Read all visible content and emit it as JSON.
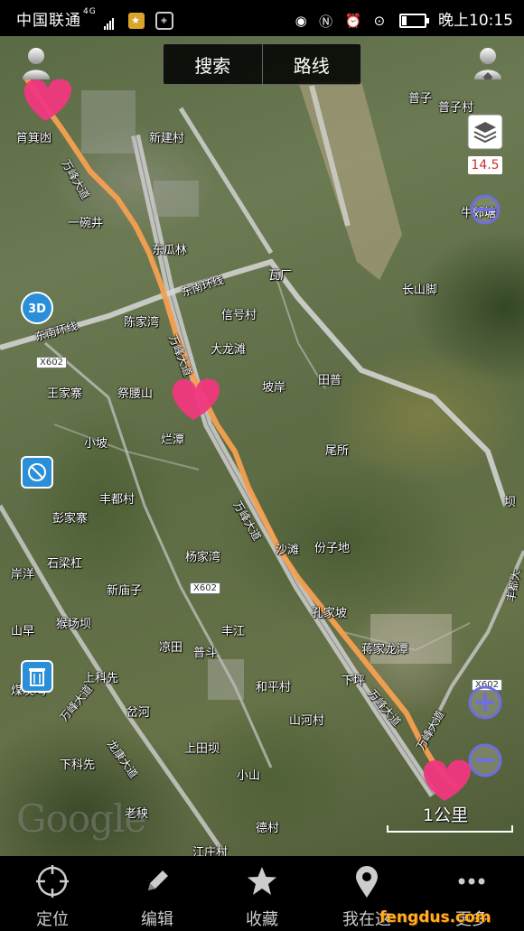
{
  "status_bar": {
    "carrier": "中国联通",
    "network": "4G",
    "time": "晚上10:15"
  },
  "top_bar": {
    "search_label": "搜索",
    "route_label": "路线"
  },
  "map": {
    "zoom_level": "14.5",
    "scale_label": "1公里",
    "attribution": "Google",
    "road_tags": [
      "X602",
      "X602",
      "X602"
    ],
    "places": {
      "jiluwan": "筲箕凼",
      "xinjiancun": "新建村",
      "puzi": "普子",
      "puzicun": "普子村",
      "niujiaotang": "牛郊塘",
      "yiwanjing": "一碗井",
      "dongualin": "东瓜林",
      "wachang": "瓦厂",
      "changshanjiao": "长山脚",
      "chenjiawan": "陈家湾",
      "xinhaocun": "信号村",
      "dalongtan": "大龙滩",
      "wangjiazhai": "王家寨",
      "jiyaoshan": "祭腰山",
      "poan": "坡岸",
      "tianpu": "田普",
      "xiaopo": "小坡",
      "lantan": "烂潭",
      "weisuo": "尾所",
      "fengducun": "丰都村",
      "pengjiazhai": "彭家寨",
      "shaitan": "沙滩",
      "fenzidi": "份子地",
      "kanba": "坝",
      "shiliangang": "石梁杠",
      "anyang": "岸洋",
      "yangjiawan": "杨家湾",
      "xinmiaozi": "新庙子",
      "kongjiapo": "孔家坡",
      "shanzao": "山早",
      "houchangba": "猴场坝",
      "jiangjialongtan": "蒋家龙潭",
      "liangtian": "凉田",
      "fengjiang": "丰江",
      "pudou": "普斗",
      "shangkexian": "上科先",
      "hepingcun": "和平村",
      "xiaping": "下坪",
      "meitanwan": "煤炭塆",
      "chahe": "岔河",
      "shanhecun": "山河村",
      "shangtianba": "上田坝",
      "xiakexian": "下科先",
      "xiaoshan": "小山",
      "laoyang": "老秧",
      "decun": "德村",
      "jiangtangcun": "江庄村"
    },
    "roads": {
      "wanfeng_1": "万峰大道",
      "wanfeng_2": "万峰大道",
      "wanfeng_3": "万峰大道",
      "wanfeng_4": "万峰大道",
      "wanfeng_5": "万峰大道",
      "wanfeng_6": "万峰大道",
      "dongnan_1": "东南环线",
      "dongnan_2": "东南环线",
      "longkang": "龙康大道",
      "feng_right": "丰都大"
    }
  },
  "tab_bar": {
    "tabs": [
      {
        "label": "定位",
        "icon": "crosshair-icon"
      },
      {
        "label": "编辑",
        "icon": "pencil-icon"
      },
      {
        "label": "收藏",
        "icon": "star-icon"
      },
      {
        "label": "我在这",
        "icon": "map-pin-icon"
      },
      {
        "label": "更多",
        "icon": "more-icon"
      }
    ]
  },
  "watermark": "fengdus.com",
  "colors": {
    "route": "#f6a050",
    "marker": "#f0377f",
    "button_blue": "#2a8fd8",
    "zoom_btn": "#6e6ee0"
  }
}
